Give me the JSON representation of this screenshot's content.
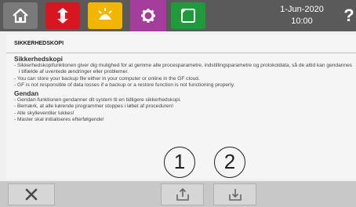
{
  "topbar": {
    "date": "1-Jun-2020",
    "time": "10:00",
    "help_label": "?"
  },
  "page": {
    "title": "SIKKERHEDSKOPI"
  },
  "content": {
    "backup_heading": "Sikkerhedskopi",
    "backup_items": [
      "- Sikkerhedskopifunktionen giver dig mulighed for at gemme alle procesparametre, indstillingsparametre og protokoldata, så de altid kan gendannes i tilfælde af uventede ændringer eller problemer.",
      "- You can store your backup file either in your computer or online in the GF cloud.",
      "- GF is not responsible of data losses if a backup or a restore function is not functioning properly."
    ],
    "restore_heading": "Gendan",
    "restore_items": [
      "- Gendan-funktionen gendanner dit system til en tidligere sikkerhedskopi.",
      "- Bemærk, at alle kørende programmer stoppes i løbet af proceduren!",
      "- Alle skylleventiler lukkes!",
      "- Master skal initialiseres efterfølgende!"
    ]
  },
  "callouts": {
    "one": "1",
    "two": "2"
  },
  "colors": {
    "topbar": "#5a5a5a",
    "tab_home": "#7a7a7a",
    "tab_transfer": "#d8161f",
    "tab_sun": "#f2b600",
    "tab_settings": "#a43d9b",
    "tab_square": "#1f9b3c"
  },
  "icons": {
    "tabs": [
      "home-icon",
      "transfer-arrows-icon",
      "sun-icon",
      "gear-icon",
      "square-icon"
    ],
    "bottom": [
      "close-icon",
      "upload-icon",
      "download-icon"
    ]
  }
}
